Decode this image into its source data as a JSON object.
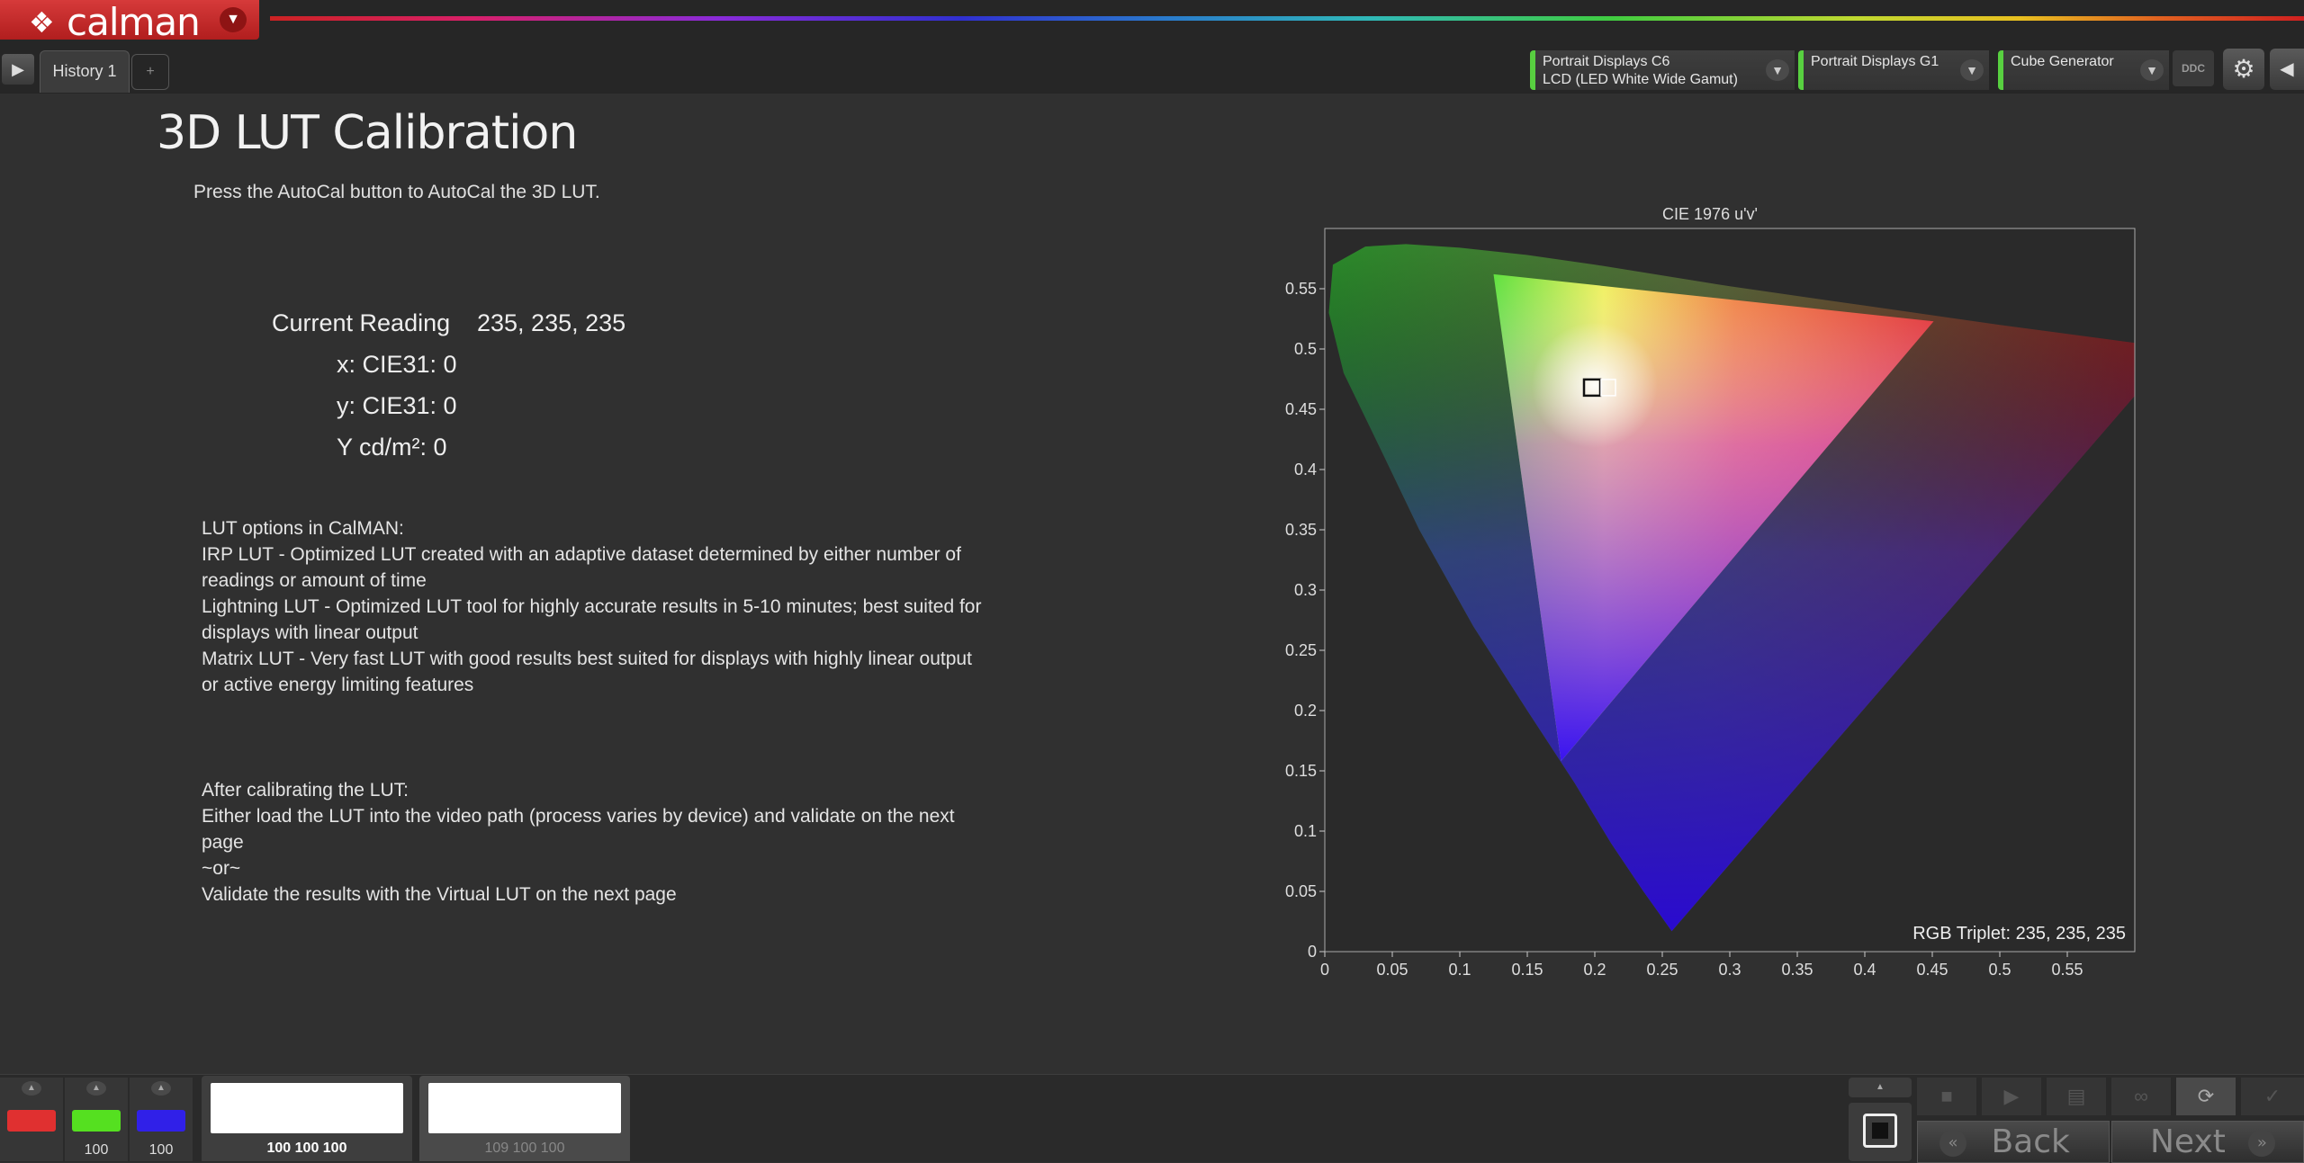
{
  "app": {
    "logo_text": "calman",
    "logo_mark": "❖"
  },
  "tabs": {
    "history_label": "History 1",
    "add_label": "+"
  },
  "devices": [
    {
      "line1": "Portrait Displays C6",
      "line2": "LCD (LED White Wide Gamut)"
    },
    {
      "line1": "Portrait Displays G1",
      "line2": ""
    },
    {
      "line1": "Cube Generator",
      "line2": ""
    }
  ],
  "toolbar": {
    "ddc_label": "DDC"
  },
  "page": {
    "title": "3D LUT Calibration",
    "subtitle": "Press the AutoCal button to AutoCal the 3D LUT."
  },
  "reading": {
    "label": "Current Reading",
    "value": "235, 235, 235",
    "x": "x: CIE31: 0",
    "y": "y: CIE31: 0",
    "Y": "Y cd/m²: 0"
  },
  "info": {
    "lut_options": [
      "LUT options in CalMAN:",
      "IRP LUT - Optimized LUT created with an adaptive dataset determined by either number of readings or amount of time",
      "Lightning LUT - Optimized LUT tool for highly accurate results in 5-10 minutes; best suited for displays with linear output",
      "Matrix LUT - Very fast LUT with good results best suited for displays with highly linear output or active energy limiting features"
    ],
    "after": [
      "After calibrating the LUT:",
      "Either load the LUT into the video path (process varies by device) and validate on the next page",
      "~or~",
      "Validate the results with the Virtual LUT on the next page"
    ]
  },
  "chart_data": {
    "type": "scatter",
    "title": "CIE 1976 u'v'",
    "xlim": [
      0,
      0.6
    ],
    "ylim": [
      0,
      0.6
    ],
    "x_ticks": [
      "0",
      "0.05",
      "0.1",
      "0.15",
      "0.2",
      "0.25",
      "0.3",
      "0.35",
      "0.4",
      "0.45",
      "0.5",
      "0.55"
    ],
    "y_ticks": [
      "0",
      "0.05",
      "0.1",
      "0.15",
      "0.2",
      "0.25",
      "0.3",
      "0.35",
      "0.4",
      "0.45",
      "0.5",
      "0.55"
    ],
    "gamut_triangle": {
      "red": [
        0.451,
        0.523
      ],
      "green": [
        0.125,
        0.562
      ],
      "blue": [
        0.175,
        0.158
      ]
    },
    "target_point": {
      "u": 0.198,
      "v": 0.468
    },
    "measured_point": {
      "u": 0.21,
      "v": 0.468
    },
    "annotation": "RGB Triplet: 235, 235, 235"
  },
  "bottom": {
    "swatches": [
      {
        "color": "#e03030",
        "value": ""
      },
      {
        "color": "#55e020",
        "value": "100"
      },
      {
        "color": "#3020e8",
        "value": "100"
      }
    ],
    "patches": [
      {
        "caption": "100 100 100",
        "active": true
      },
      {
        "caption": "109 100 100",
        "active": false
      }
    ],
    "back_label": "Back",
    "next_label": "Next"
  }
}
